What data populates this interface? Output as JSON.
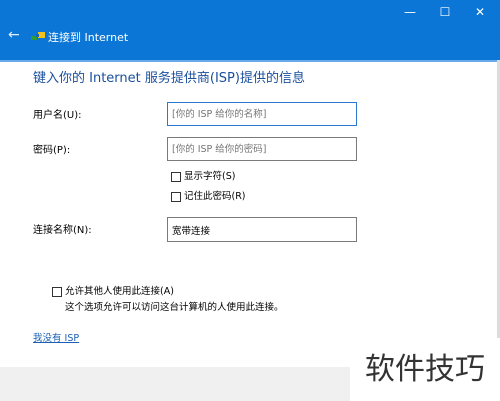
{
  "window": {
    "back_icon": "←",
    "title": "连接到 Internet",
    "minimize_glyph": "—",
    "maximize_glyph": "☐",
    "close_glyph": "✕"
  },
  "heading": "键入你的 Internet 服务提供商(ISP)提供的信息",
  "form": {
    "username_label": "用户名(U):",
    "username_placeholder": "[你的 ISP 给你的名称]",
    "password_label": "密码(P):",
    "password_placeholder": "[你的 ISP 给你的密码]",
    "show_chars_label": "显示字符(S)",
    "remember_password_label": "记住此密码(R)",
    "connection_name_label": "连接名称(N):",
    "connection_name_value": "宽带连接",
    "allow_others_label": "允许其他人使用此连接(A)",
    "allow_others_desc": "这个选项允许可以访问这台计算机的人使用此连接。"
  },
  "links": {
    "no_isp": "我没有 ISP"
  },
  "watermark": "软件技巧",
  "colors": {
    "titlebar": "#0b76d6",
    "heading": "#1a4f9c",
    "link": "#1a5fb4"
  }
}
